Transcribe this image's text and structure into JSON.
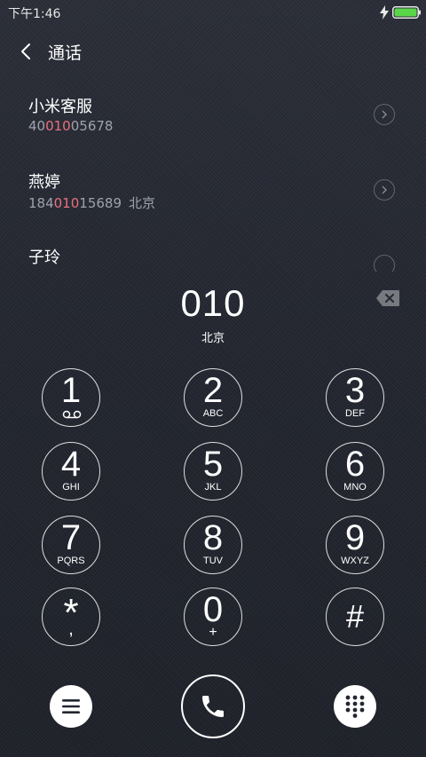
{
  "status_bar": {
    "time": "下午1:46",
    "battery_color": "#5ad64a",
    "icons": [
      "charge-icon",
      "battery-icon"
    ]
  },
  "header": {
    "title": "通话",
    "back_icon": "chevron-left-icon"
  },
  "contacts": [
    {
      "name": "小米客服",
      "number_prefix": "40",
      "number_match": "010",
      "number_suffix": "05678",
      "location": ""
    },
    {
      "name": "燕婷",
      "number_prefix": "184",
      "number_match": "010",
      "number_suffix": "15689",
      "location": "北京"
    },
    {
      "name": "子玲",
      "number_prefix": "",
      "number_match": "",
      "number_suffix": "",
      "location": ""
    }
  ],
  "highlight_color": "#e9707e",
  "dialer": {
    "number": "010",
    "location": "北京",
    "backspace_icon": "backspace-icon"
  },
  "keypad": [
    {
      "digit": "1",
      "letters": "",
      "icon": "voicemail-icon"
    },
    {
      "digit": "2",
      "letters": "ABC"
    },
    {
      "digit": "3",
      "letters": "DEF"
    },
    {
      "digit": "4",
      "letters": "GHI"
    },
    {
      "digit": "5",
      "letters": "JKL"
    },
    {
      "digit": "6",
      "letters": "MNO"
    },
    {
      "digit": "7",
      "letters": "PQRS"
    },
    {
      "digit": "8",
      "letters": "TUV"
    },
    {
      "digit": "9",
      "letters": "WXYZ"
    },
    {
      "digit": "*",
      "letters": ","
    },
    {
      "digit": "0",
      "letters": "+"
    },
    {
      "digit": "#",
      "letters": ""
    }
  ],
  "bottom_bar": {
    "menu_icon": "menu-icon",
    "call_icon": "phone-icon",
    "dialpad_icon": "dialpad-icon"
  }
}
